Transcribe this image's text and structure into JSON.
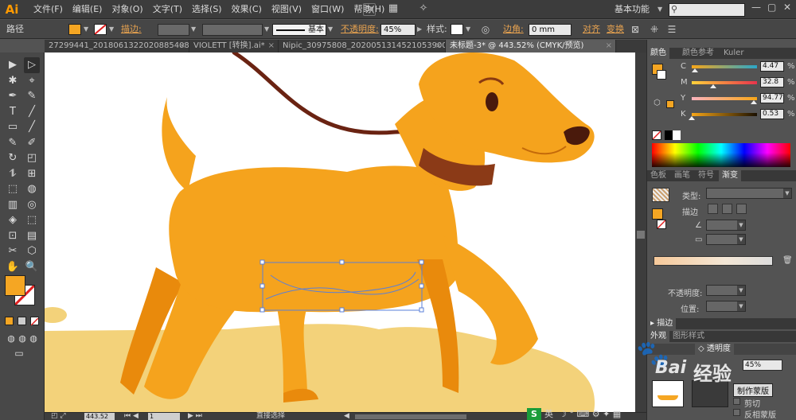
{
  "app": {
    "logo": "Ai"
  },
  "menu": [
    "文件(F)",
    "编辑(E)",
    "对象(O)",
    "文字(T)",
    "选择(S)",
    "效果(C)",
    "视图(V)",
    "窗口(W)",
    "帮助(H)"
  ],
  "menubar": {
    "bridge_icon": "Br",
    "arrange_icon": "▦",
    "gpu_icon": "✧",
    "workspace": "基本功能",
    "search_placeholder": "",
    "min": "—",
    "max": "▢",
    "close": "✕"
  },
  "control": {
    "title": "路径",
    "stroke_label": "描边:",
    "stroke_profile": "基本",
    "opacity_label": "不透明度:",
    "opacity_value": "45%",
    "style_label": "样式:",
    "corner_label": "边角:",
    "corner_value": "0 mm",
    "align_label": "对齐",
    "transform_label": "变换",
    "fill_color": "#f5a623"
  },
  "tabs": [
    {
      "label": "27299441_20180613220208854088.ai*",
      "active": false
    },
    {
      "label": "VIOLETT [转换].ai*",
      "active": false
    },
    {
      "label": "Nipic_30975808_20200513145210539000.ai*",
      "active": false
    },
    {
      "label": "未标题-3* @ 443.52% (CMYK/预览)",
      "active": true
    }
  ],
  "tools": [
    "▶",
    "▷",
    "✱",
    "⌖",
    "✒",
    "✎",
    "T",
    "╱",
    "▭",
    "╱",
    "✎",
    "✐",
    "↻",
    "◰",
    "⥮",
    "⊞",
    "⬚",
    "◍",
    "▥",
    "◎",
    "◈",
    "⬚",
    "⊡",
    "▤",
    "✂",
    "⬡",
    "✋",
    "🔍"
  ],
  "status": {
    "zoom": "443.52",
    "page": "1",
    "tool_name": "直接选择"
  },
  "color_panel": {
    "tabs": [
      "颜色",
      "颜色参考",
      "Kuler"
    ],
    "channels": [
      {
        "label": "C",
        "value": "4.47",
        "fraction": 0.045,
        "gradient": "linear-gradient(90deg,#f7a618,#2aa7c9)"
      },
      {
        "label": "M",
        "value": "32.8",
        "fraction": 0.328,
        "gradient": "linear-gradient(90deg,#ffd23a,#e8334c)"
      },
      {
        "label": "Y",
        "value": "94.77",
        "fraction": 0.948,
        "gradient": "linear-gradient(90deg,#f9b2bd,#f7a618)"
      },
      {
        "label": "K",
        "value": "0.53",
        "fraction": 0.005,
        "gradient": "linear-gradient(90deg,#f7a618,#1a1000)"
      }
    ]
  },
  "gradient_panel": {
    "tabs": [
      "色板",
      "画笔",
      "符号",
      "渐变"
    ],
    "type_label": "类型:",
    "stroke_label": "描边",
    "opacity_label": "不透明度:",
    "position_label": "位置:"
  },
  "stroke_panel": {
    "title": "描边"
  },
  "appearance_panel": {
    "tabs": [
      "外观",
      "图形样式"
    ],
    "transparency_tab": "透明度",
    "percent": "45%",
    "mask_button": "制作蒙版",
    "clip_label": "剪切",
    "invert_label": "反相蒙版"
  },
  "ime": {
    "logo": "S",
    "lang": "英"
  },
  "watermark": {
    "brand": "Bai",
    "text": "经验"
  }
}
